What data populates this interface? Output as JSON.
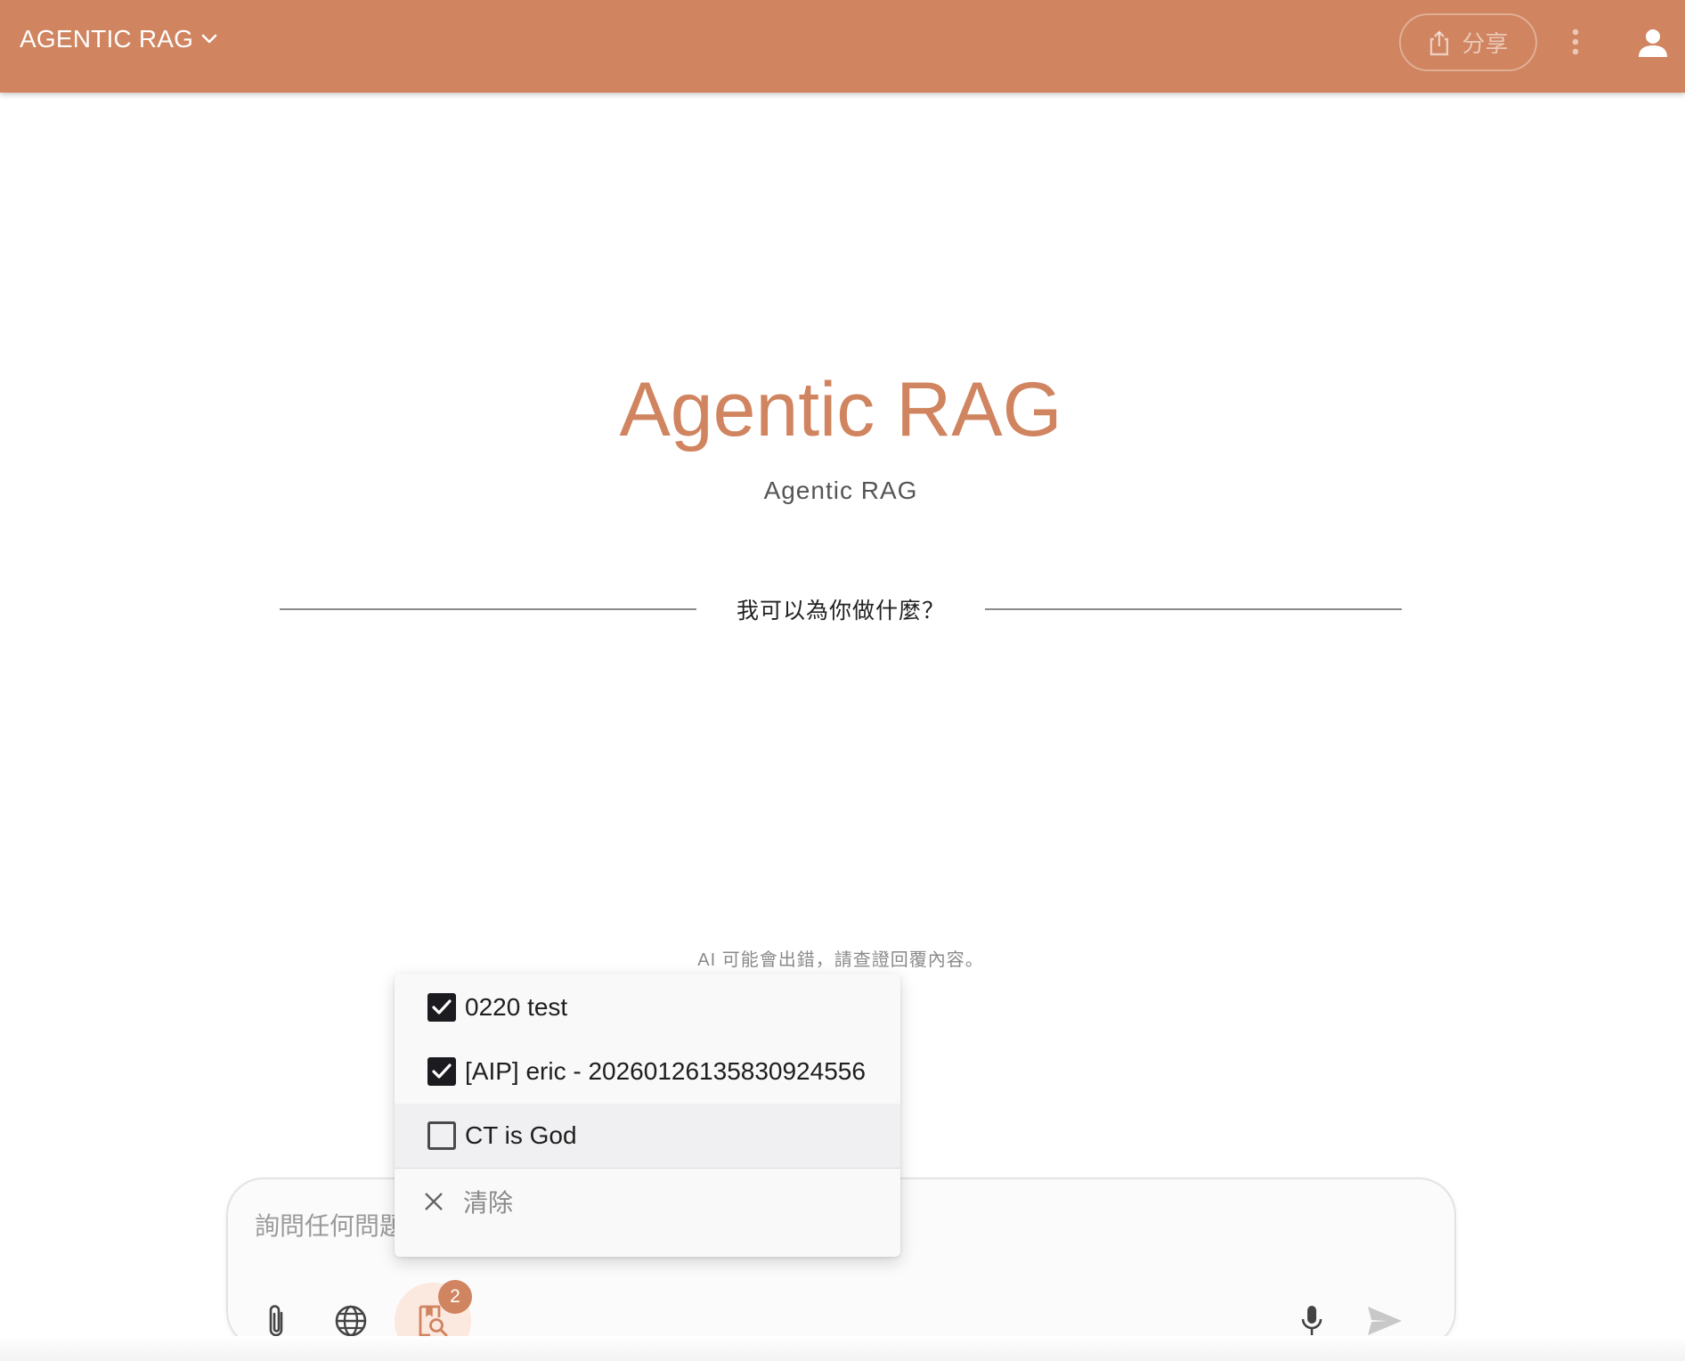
{
  "colors": {
    "brand": "#d0845f",
    "badge": "#d0845f",
    "kb_button_bg": "#fbe8df"
  },
  "header": {
    "app_name": "AGENTIC RAG",
    "share_label": "分享",
    "icons": [
      "chevron-down-icon",
      "share-icon",
      "more-vert-icon",
      "user-icon"
    ]
  },
  "hero": {
    "title": "Agentic RAG",
    "subtitle": "Agentic RAG",
    "prompt": "我可以為你做什麼？"
  },
  "disclaimer": "AI 可能會出錯，請查證回覆內容。",
  "kb_menu": {
    "items": [
      {
        "label": "0220 test",
        "checked": true
      },
      {
        "label": "[AIP] eric - 20260126135830924556",
        "checked": true
      },
      {
        "label": "CT is God",
        "checked": false
      }
    ],
    "clear_label": "清除"
  },
  "chat": {
    "placeholder": "詢問任何問題",
    "kb_selected_count": "2",
    "icons": [
      "attach-icon",
      "globe-icon",
      "knowledge-search-icon",
      "mic-icon",
      "send-icon"
    ]
  }
}
